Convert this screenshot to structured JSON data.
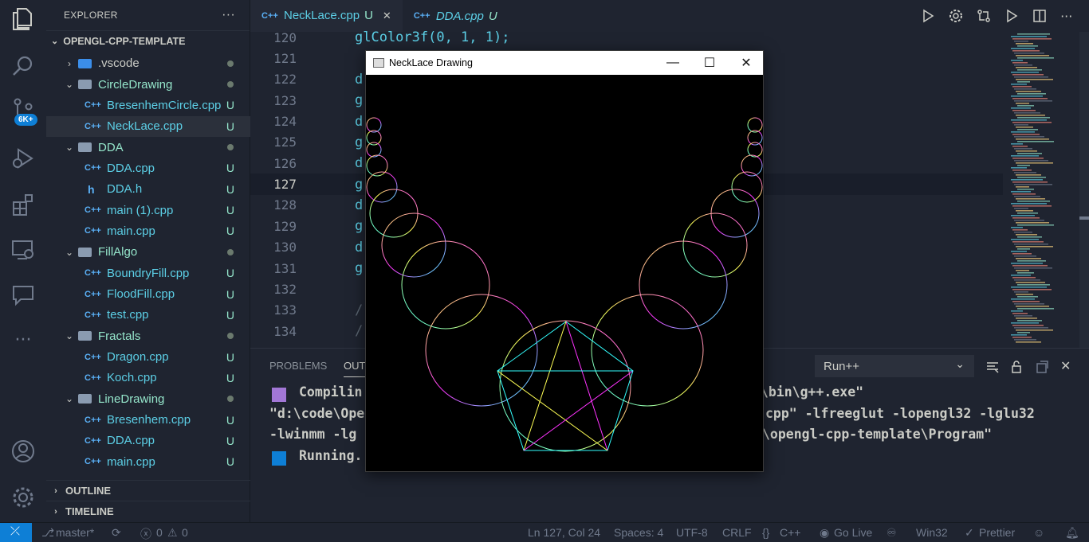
{
  "activity_bar": {
    "scm_badge": "6K+",
    "icons": [
      "explorer-icon",
      "search-icon",
      "source-control-icon",
      "run-debug-icon",
      "extensions-icon",
      "remote-explorer-icon",
      "comments-icon",
      "more-icon",
      "account-icon",
      "settings-icon"
    ]
  },
  "explorer": {
    "title": "EXPLORER",
    "more": "···",
    "project": "OPENGL-CPP-TEMPLATE",
    "tree": [
      {
        "name": ".vscode",
        "kind": "folder",
        "expanded": false,
        "depth": 1,
        "status": "dot"
      },
      {
        "name": "CircleDrawing",
        "kind": "folder",
        "expanded": true,
        "depth": 1,
        "status": "dot"
      },
      {
        "name": "BresenhemCircle.cpp",
        "kind": "cpp",
        "depth": 2,
        "status": "U"
      },
      {
        "name": "NeckLace.cpp",
        "kind": "cpp",
        "depth": 2,
        "status": "U",
        "selected": true
      },
      {
        "name": "DDA",
        "kind": "folder",
        "expanded": true,
        "depth": 1,
        "status": "dot"
      },
      {
        "name": "DDA.cpp",
        "kind": "cpp",
        "depth": 2,
        "status": "U"
      },
      {
        "name": "DDA.h",
        "kind": "h",
        "depth": 2,
        "status": "U"
      },
      {
        "name": "main (1).cpp",
        "kind": "cpp",
        "depth": 2,
        "status": "U"
      },
      {
        "name": "main.cpp",
        "kind": "cpp",
        "depth": 2,
        "status": "U"
      },
      {
        "name": "FillAlgo",
        "kind": "folder",
        "expanded": true,
        "depth": 1,
        "status": "dot"
      },
      {
        "name": "BoundryFill.cpp",
        "kind": "cpp",
        "depth": 2,
        "status": "U"
      },
      {
        "name": "FloodFill.cpp",
        "kind": "cpp",
        "depth": 2,
        "status": "U"
      },
      {
        "name": "test.cpp",
        "kind": "cpp",
        "depth": 2,
        "status": "U"
      },
      {
        "name": "Fractals",
        "kind": "folder",
        "expanded": true,
        "depth": 1,
        "status": "dot"
      },
      {
        "name": "Dragon.cpp",
        "kind": "cpp",
        "depth": 2,
        "status": "U"
      },
      {
        "name": "Koch.cpp",
        "kind": "cpp",
        "depth": 2,
        "status": "U"
      },
      {
        "name": "LineDrawing",
        "kind": "folder",
        "expanded": true,
        "depth": 1,
        "status": "dot"
      },
      {
        "name": "Bresenhem.cpp",
        "kind": "cpp",
        "depth": 2,
        "status": "U"
      },
      {
        "name": "DDA.cpp",
        "kind": "cpp",
        "depth": 2,
        "status": "U"
      },
      {
        "name": "main.cpp",
        "kind": "cpp",
        "depth": 2,
        "status": "U"
      }
    ],
    "outline": "OUTLINE",
    "timeline": "TIMELINE"
  },
  "tabs": [
    {
      "prefix": "C++",
      "label": "NeckLace.cpp",
      "status": "U",
      "close": "✕",
      "active": true
    },
    {
      "prefix": "C++",
      "label": "DDA.cpp",
      "status": "U",
      "active": false
    }
  ],
  "editor": {
    "lines": [
      {
        "num": "120",
        "code": "glColor3f(0, 1, 1);"
      },
      {
        "num": "121",
        "code": ""
      },
      {
        "num": "122",
        "code": "d"
      },
      {
        "num": "123",
        "code": "g"
      },
      {
        "num": "124",
        "code": "d"
      },
      {
        "num": "125",
        "code": "g"
      },
      {
        "num": "126",
        "code": "d"
      },
      {
        "num": "127",
        "code": "g",
        "current": true
      },
      {
        "num": "128",
        "code": "d"
      },
      {
        "num": "129",
        "code": "g"
      },
      {
        "num": "130",
        "code": "d"
      },
      {
        "num": "131",
        "code": "g"
      },
      {
        "num": "132",
        "code": ""
      },
      {
        "num": "133",
        "code": "/"
      },
      {
        "num": "134",
        "code": "/"
      }
    ]
  },
  "panel": {
    "tabs": [
      "PROBLEMS",
      "OUT"
    ],
    "select_value": "Run++",
    "output": [
      {
        "marker": "purple",
        "text": "Compilin"
      },
      {
        "marker": "",
        "text": "\"d:\\code\\Ope"
      },
      {
        "marker": "",
        "text": "-lwinmm -lg"
      },
      {
        "marker": "blue",
        "text": "Running."
      }
    ],
    "output_right": [
      "2\\bin\\g++.exe\"",
      "cpp\" -lfreeglut -lopengl32 -lglu32",
      "\\opengl-cpp-template\\Program\""
    ]
  },
  "gl_window": {
    "title": "NeckLace Drawing",
    "min": "—",
    "max": "☐",
    "close": "✕"
  },
  "statusbar": {
    "branch": "master*",
    "errors": "0",
    "warnings": "0",
    "position": "Ln 127, Col 24",
    "spaces": "Spaces: 4",
    "encoding": "UTF-8",
    "eol": "CRLF",
    "language": "C++",
    "golive": "Go Live",
    "platform": "Win32",
    "prettier": "Prettier"
  },
  "colors": {
    "accent": "#0e7fd6",
    "bg": "#1f2430",
    "cyan": "#5ccfe6",
    "green": "#95e6cb",
    "yellow_fn": "#ffd580"
  }
}
